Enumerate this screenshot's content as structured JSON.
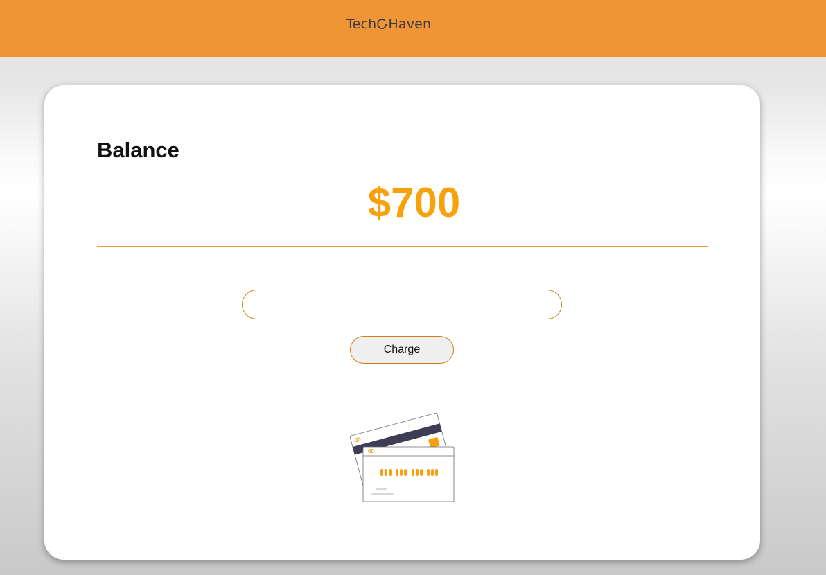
{
  "header": {
    "brand_prefix": "Tech",
    "brand_suffix": "Haven",
    "color": "#ef9535"
  },
  "balance": {
    "title": "Balance",
    "amount": "$700",
    "amount_color": "#f7a20c"
  },
  "charge_form": {
    "input_value": "",
    "input_placeholder": "",
    "button_label": "Charge"
  },
  "illustration": {
    "icon": "credit-cards-illustration",
    "accent_color": "#f7a20c",
    "stripe_color": "#3f3d56"
  }
}
